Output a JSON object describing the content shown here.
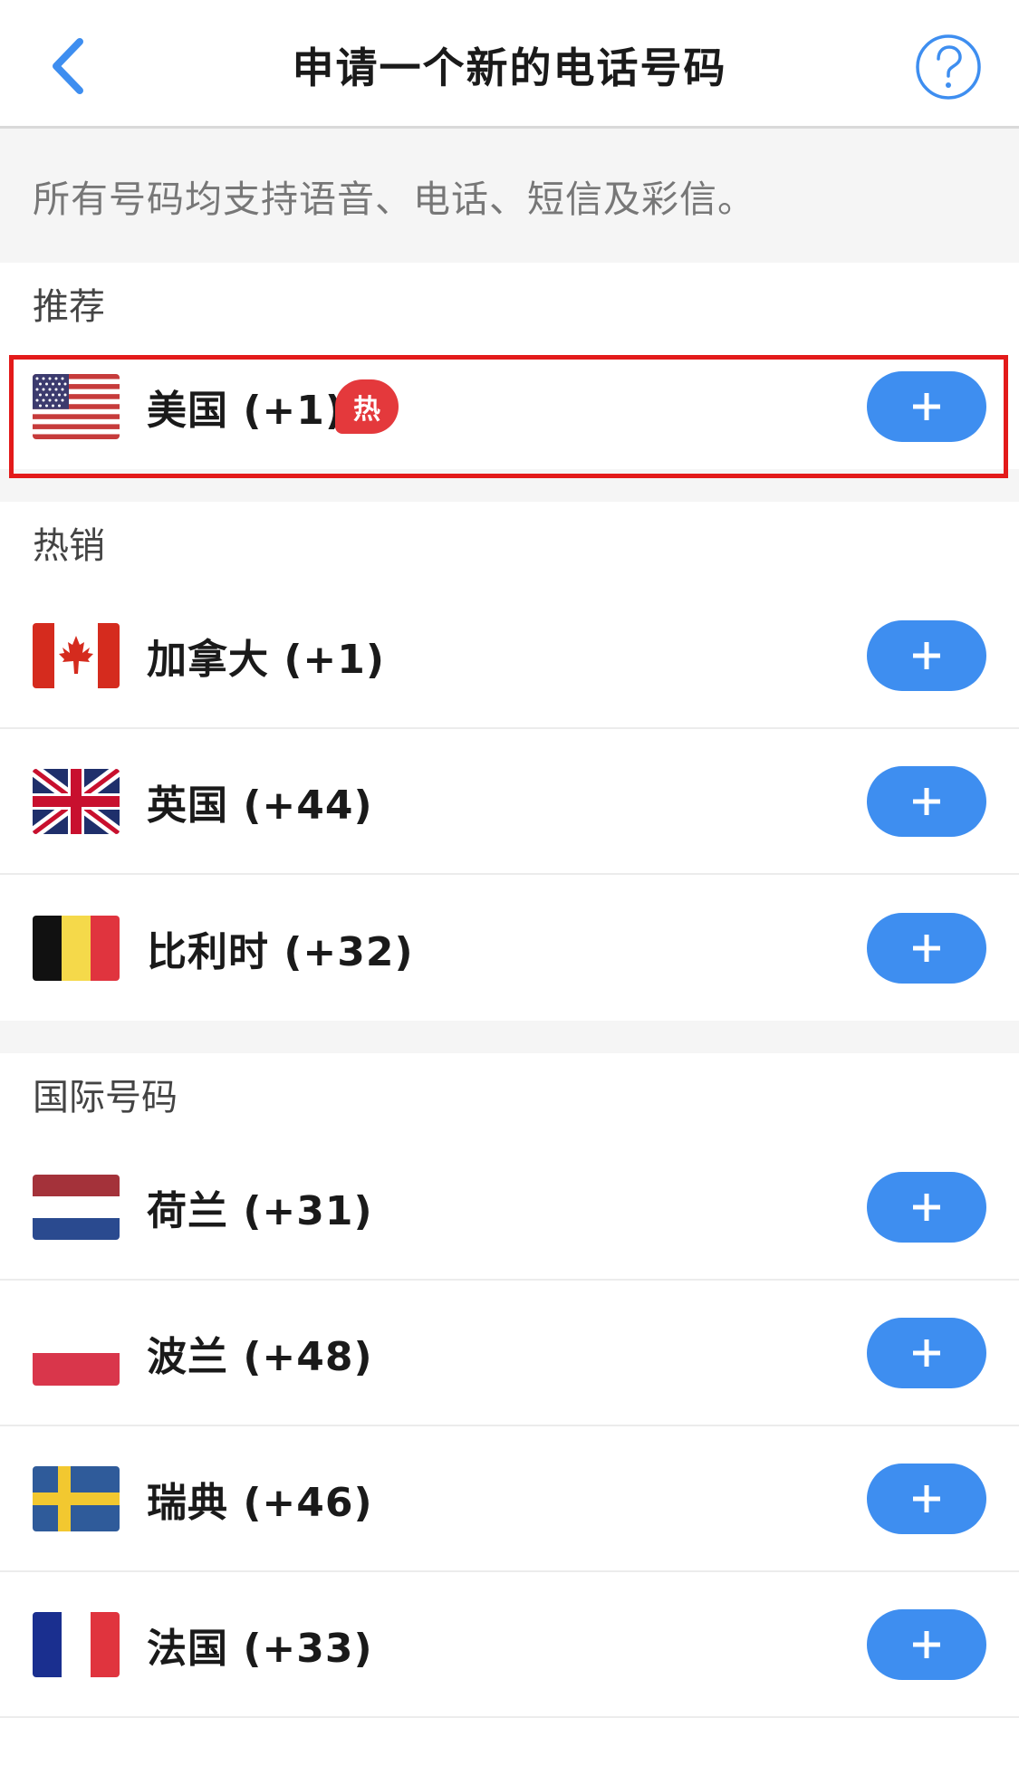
{
  "header": {
    "title": "申请一个新的电话号码",
    "back_icon": "chevron-left-icon",
    "help_icon": "question-circle-icon",
    "accent_color": "#3e8ef0"
  },
  "info": {
    "text": "所有号码均支持语音、电话、短信及彩信。"
  },
  "sections": [
    {
      "title": "推荐",
      "items": [
        {
          "country": "美国 (+1)",
          "flag": "us-flag-icon",
          "badge": "热",
          "button": "+"
        }
      ]
    },
    {
      "title": "热销",
      "items": [
        {
          "country": "加拿大 (+1)",
          "flag": "ca-flag-icon",
          "button": "+"
        },
        {
          "country": "英国 (+44)",
          "flag": "uk-flag-icon",
          "button": "+"
        },
        {
          "country": "比利时 (+32)",
          "flag": "be-flag-icon",
          "button": "+"
        }
      ]
    },
    {
      "title": "国际号码",
      "items": [
        {
          "country": "荷兰 (+31)",
          "flag": "nl-flag-icon",
          "button": "+"
        },
        {
          "country": "波兰 (+48)",
          "flag": "pl-flag-icon",
          "button": "+"
        },
        {
          "country": "瑞典 (+46)",
          "flag": "se-flag-icon",
          "button": "+"
        },
        {
          "country": "法国 (+33)",
          "flag": "fr-flag-icon",
          "button": "+"
        }
      ]
    }
  ],
  "colors": {
    "add_button": "#3e8ef0",
    "hot_badge": "#e4393c",
    "highlight_border": "#e31a1a"
  }
}
